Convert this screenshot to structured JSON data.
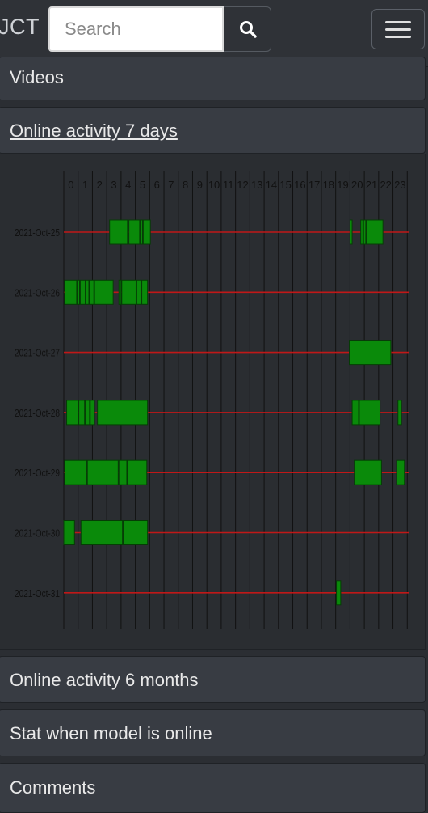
{
  "header": {
    "brand": "JCT",
    "search_placeholder": "Search",
    "search_icon": "search-icon",
    "menu_icon": "hamburger-menu-icon"
  },
  "sections": {
    "videos": "Videos",
    "activity_7d": "Online activity 7 days",
    "activity_6m": "Online activity 6 months",
    "stat_online": "Stat when model is online",
    "comments": "Comments"
  },
  "colors": {
    "bar_fill": "#0a8a0a",
    "bar_stroke": "#053d05",
    "timeline": "#c01818",
    "grid": "#111111"
  },
  "chart_data": {
    "type": "timeline",
    "x_unit": "hour of day",
    "hours": [
      "0",
      "1",
      "2",
      "3",
      "4",
      "5",
      "6",
      "7",
      "8",
      "9",
      "10",
      "11",
      "12",
      "13",
      "14",
      "15",
      "16",
      "17",
      "18",
      "19",
      "20",
      "21",
      "22",
      "23"
    ],
    "days": [
      {
        "date": "2021-Oct-25",
        "sessions": [
          [
            3.2,
            4.45
          ],
          [
            4.55,
            5.3
          ],
          [
            5.35,
            5.5
          ],
          [
            5.55,
            6.05
          ],
          [
            20.0,
            20.15
          ],
          [
            20.75,
            20.9
          ],
          [
            20.95,
            21.1
          ],
          [
            21.15,
            22.3
          ]
        ]
      },
      {
        "date": "2021-Oct-26",
        "sessions": [
          [
            0.05,
            0.9
          ],
          [
            0.95,
            1.1
          ],
          [
            1.15,
            1.5
          ],
          [
            1.55,
            1.75
          ],
          [
            1.8,
            2.1
          ],
          [
            2.15,
            3.45
          ],
          [
            3.85,
            4.0
          ],
          [
            4.05,
            5.05
          ],
          [
            5.1,
            5.4
          ],
          [
            5.45,
            5.85
          ]
        ]
      },
      {
        "date": "2021-Oct-27",
        "sessions": [
          [
            19.95,
            22.85
          ]
        ]
      },
      {
        "date": "2021-Oct-28",
        "sessions": [
          [
            0.2,
            1.0
          ],
          [
            1.05,
            1.45
          ],
          [
            1.5,
            1.8
          ],
          [
            1.85,
            2.15
          ],
          [
            2.35,
            5.85
          ],
          [
            20.15,
            20.6
          ],
          [
            20.65,
            22.1
          ],
          [
            23.35,
            23.6
          ]
        ]
      },
      {
        "date": "2021-Oct-29",
        "sessions": [
          [
            0.05,
            1.6
          ],
          [
            1.65,
            3.8
          ],
          [
            3.85,
            4.4
          ],
          [
            4.45,
            5.8
          ],
          [
            20.3,
            22.2
          ],
          [
            23.25,
            23.8
          ]
        ]
      },
      {
        "date": "2021-Oct-30",
        "sessions": [
          [
            0.0,
            0.75
          ],
          [
            1.2,
            4.1
          ],
          [
            4.15,
            5.85
          ]
        ]
      },
      {
        "date": "2021-Oct-31",
        "sessions": [
          [
            19.05,
            19.35
          ]
        ]
      }
    ]
  }
}
